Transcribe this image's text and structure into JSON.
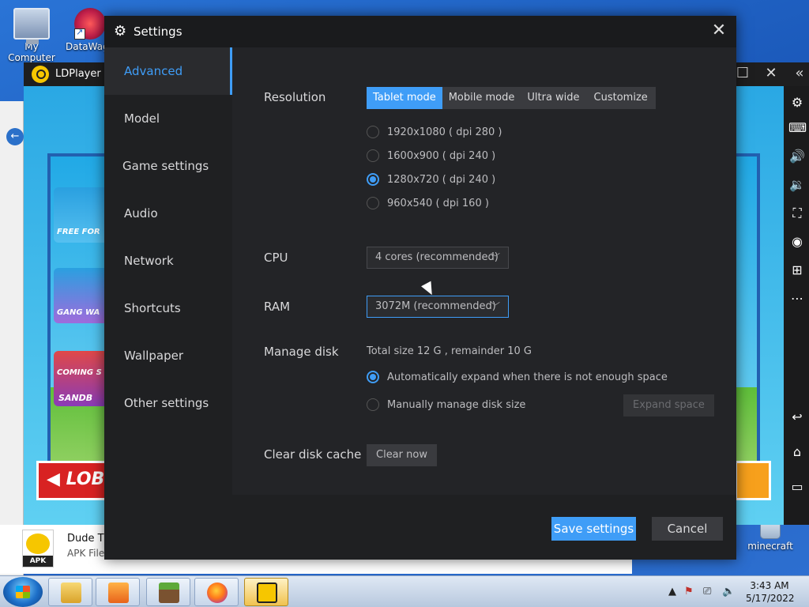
{
  "desktop": {
    "icons": [
      {
        "label": "My Computer"
      },
      {
        "label": "DataWago"
      }
    ],
    "minecraft_label": "minecraft"
  },
  "ldplayer": {
    "title": "LDPlayer",
    "game_button": "LOB",
    "card_labels": [
      "FREE FOR",
      "GANG WA",
      "COMING S",
      "SANDB"
    ]
  },
  "explorer": {
    "file_name": "Dude Th",
    "file_type": "APK File",
    "apk_badge": "APK"
  },
  "settings": {
    "title": "Settings",
    "nav": [
      "Advanced",
      "Model",
      "Game settings",
      "Audio",
      "Network",
      "Shortcuts",
      "Wallpaper",
      "Other settings"
    ],
    "resolution": {
      "label": "Resolution",
      "modes": [
        "Tablet mode",
        "Mobile mode",
        "Ultra wide",
        "Customize"
      ],
      "active_mode": "Tablet mode",
      "options": [
        "1920x1080 ( dpi 280 )",
        "1600x900 ( dpi 240 )",
        "1280x720 ( dpi 240 )",
        "960x540 ( dpi 160 )"
      ],
      "selected": "1280x720 ( dpi 240 )"
    },
    "cpu": {
      "label": "CPU",
      "value": "4 cores (recommended)"
    },
    "ram": {
      "label": "RAM",
      "value": "3072M (recommended)"
    },
    "disk": {
      "label": "Manage disk",
      "info": "Total size 12 G , remainder 10 G",
      "auto": "Automatically expand when there is not enough space",
      "manual": "Manually manage disk size",
      "expand_button": "Expand space"
    },
    "cache": {
      "label": "Clear disk cache",
      "button": "Clear now"
    },
    "footer": {
      "save": "Save settings",
      "cancel": "Cancel"
    }
  },
  "taskbar": {
    "time": "3:43 AM",
    "date": "5/17/2022"
  },
  "colors": {
    "accent": "#3f9df7",
    "dialog_bg": "#232427"
  }
}
